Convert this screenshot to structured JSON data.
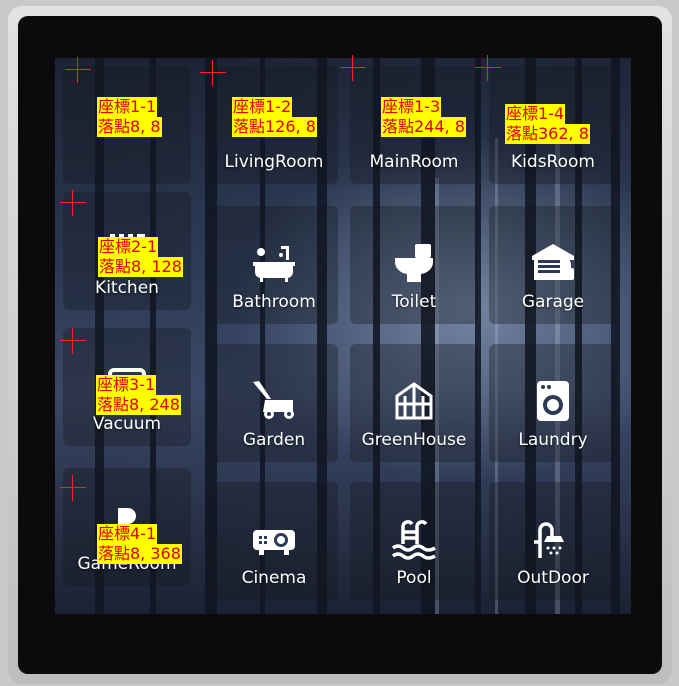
{
  "screen": {
    "tiles": [
      {
        "label": "",
        "icon": "blank-icon"
      },
      {
        "label": "LivingRoom",
        "icon": "sofa-icon"
      },
      {
        "label": "MainRoom",
        "icon": "bed-icon"
      },
      {
        "label": "KidsRoom",
        "icon": "toy-icon"
      },
      {
        "label": "Kitchen",
        "icon": "kitchen-icon"
      },
      {
        "label": "Bathroom",
        "icon": "bathtub-icon"
      },
      {
        "label": "Toilet",
        "icon": "toilet-icon"
      },
      {
        "label": "Garage",
        "icon": "garage-icon"
      },
      {
        "label": "Vacuum",
        "icon": "vacuum-icon"
      },
      {
        "label": "Garden",
        "icon": "lawnmower-icon"
      },
      {
        "label": "GreenHouse",
        "icon": "greenhouse-icon"
      },
      {
        "label": "Laundry",
        "icon": "washing-machine-icon"
      },
      {
        "label": "GameRoom",
        "icon": "gamepad-icon"
      },
      {
        "label": "Cinema",
        "icon": "projector-icon"
      },
      {
        "label": "Pool",
        "icon": "pool-icon"
      },
      {
        "label": "OutDoor",
        "icon": "outdoor-shower-icon"
      }
    ]
  },
  "annotations": [
    {
      "line1": "座標1-1",
      "line2": "落點8, 8"
    },
    {
      "line1": "座標1-2",
      "line2": "落點126, 8"
    },
    {
      "line1": "座標1-3",
      "line2": "落點244, 8"
    },
    {
      "line1": "座標1-4",
      "line2": "落點362, 8"
    },
    {
      "line1": "座標2-1",
      "line2": "落點8, 128"
    },
    {
      "line1": "座標3-1",
      "line2": "落點8, 248"
    },
    {
      "line1": "座標4-1",
      "line2": "落點8, 368"
    }
  ],
  "colors": {
    "annotation_text": "#e00000",
    "annotation_bg": "#ffff00",
    "crosshair": "#ff2020",
    "tile_label": "#ffffff"
  }
}
